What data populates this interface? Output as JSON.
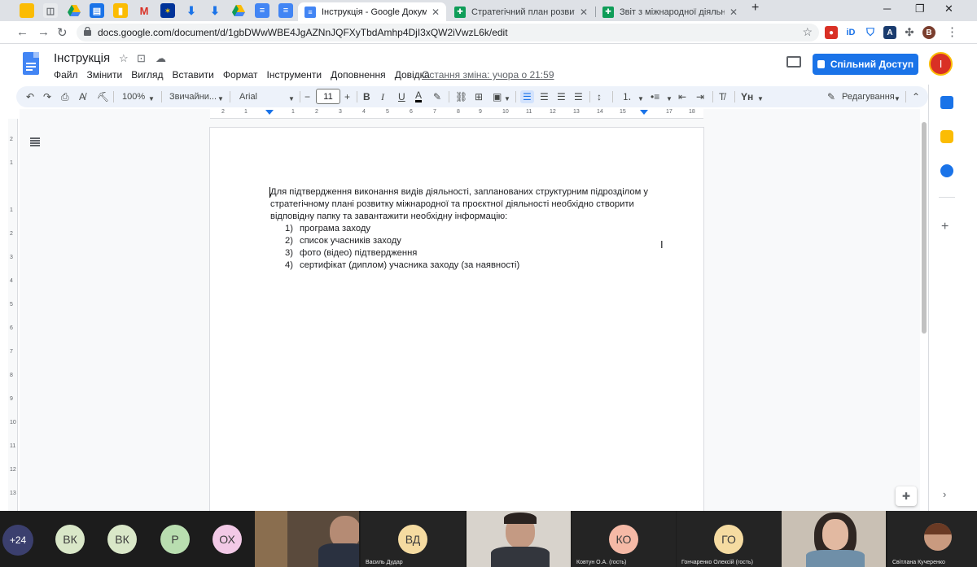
{
  "browser": {
    "tabs": [
      {
        "title": "Інструкція - Google Документи",
        "active": true
      },
      {
        "title": "Стратегічний план розвитку між",
        "active": false
      },
      {
        "title": "Звіт з міжнародної діяльності -",
        "active": false
      }
    ],
    "url": "docs.google.com/document/d/1gbDWwWBE4JgAZNnJQFXyTbdAmhp4DjI3xQW2iVwzL6k/edit",
    "profile_initial": "B"
  },
  "docs": {
    "title": "Інструкція",
    "menu": [
      "Файл",
      "Змінити",
      "Вигляд",
      "Вставити",
      "Формат",
      "Інструменти",
      "Доповнення",
      "Довідка"
    ],
    "last_edit": "Остання зміна: учора о 21:59",
    "share_label": "Спільний Доступ",
    "account_initial": "I"
  },
  "format_toolbar": {
    "zoom": "100%",
    "style": "Звичайни...",
    "font": "Arial",
    "font_size": "11",
    "mode": "Редагування"
  },
  "ruler": {
    "h_ticks": [
      "2",
      "1",
      "1",
      "2",
      "3",
      "4",
      "5",
      "6",
      "7",
      "8",
      "9",
      "10",
      "11",
      "12",
      "13",
      "14",
      "15",
      "16",
      "17",
      "18"
    ],
    "v_ticks": [
      "2",
      "1",
      "1",
      "2",
      "3",
      "4",
      "5",
      "6",
      "7",
      "8",
      "9",
      "10",
      "11",
      "12",
      "13"
    ]
  },
  "document": {
    "paragraph": "Для підтвердження виконання видів діяльності, запланованих структурним підрозділом у стратегічному плані розвитку міжнародної та проєктної діяльності необхідно створити відповідну папку та завантажити необхідну  інформацію:",
    "list": [
      {
        "num": "1)",
        "text": "програма заходу"
      },
      {
        "num": "2)",
        "text": "список учасників заходу"
      },
      {
        "num": "3)",
        "text": "фото (відео) підтвердження"
      },
      {
        "num": "4)",
        "text": "сертифікат (диплом) учасника заходу (за наявності)"
      }
    ]
  },
  "call": {
    "more_count": "+24",
    "participants": [
      {
        "initials": "ВК",
        "color": "#d9e7c8"
      },
      {
        "initials": "ВК",
        "color": "#d9e7c8"
      },
      {
        "initials": "Р",
        "color": "#b9deb0"
      },
      {
        "initials": "ОХ",
        "color": "#f2c9e6"
      },
      {
        "initials": "ВД",
        "color": "#f5dba1",
        "name": "Василь Дудар"
      },
      {
        "initials": "КО",
        "color": "#f5b9a6",
        "name": "Ковтун О.А. (гость)"
      },
      {
        "initials": "ГО",
        "color": "#f5dba1",
        "name": "Гончаренко Олексій (гость)"
      },
      {
        "name": "Світлана Кучеренко"
      }
    ]
  }
}
